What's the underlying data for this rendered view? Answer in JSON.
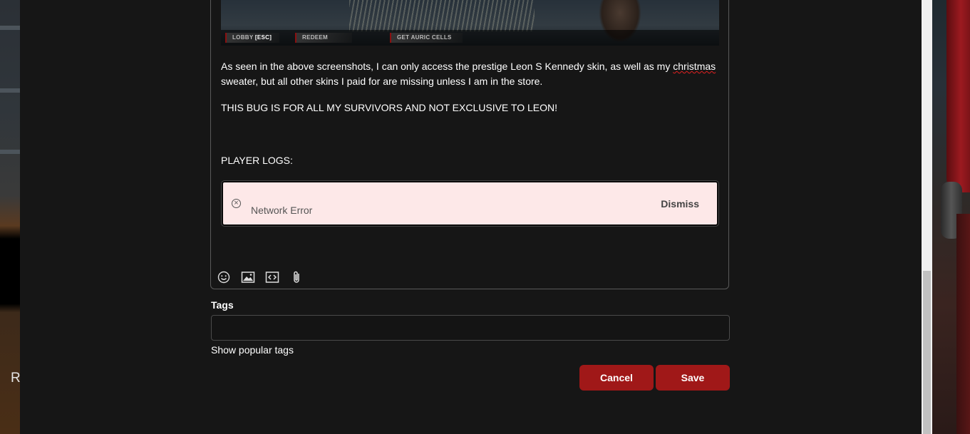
{
  "background": {
    "left_letter": "R"
  },
  "game_screenshot": {
    "buttons": [
      {
        "label": "LOBBY",
        "key": "[ESC]"
      },
      {
        "label": "REDEEM"
      },
      {
        "label": "GET AURIC CELLS"
      }
    ]
  },
  "post": {
    "paragraph1_part1": "As seen in the above screenshots, I can only access the prestige Leon S Kennedy skin, as well as my ",
    "paragraph1_misspelled": "christmas",
    "paragraph1_line2": "sweater, but all other skins I paid for are missing unless I am in the store.",
    "paragraph2": "THIS BUG IS FOR ALL MY SURVIVORS AND NOT EXCLUSIVE TO LEON!",
    "paragraph3": "PLAYER LOGS:"
  },
  "error": {
    "message": "Network Error",
    "dismiss_label": "Dismiss"
  },
  "toolbar": {
    "icons": [
      "emoji-icon",
      "image-icon",
      "code-icon",
      "attachment-icon"
    ]
  },
  "tags": {
    "label": "Tags",
    "value": "",
    "show_popular": "Show popular tags"
  },
  "actions": {
    "cancel_label": "Cancel",
    "save_label": "Save"
  },
  "colors": {
    "accent": "#a01818",
    "background": "#161616",
    "error_bg": "#fde8e8"
  }
}
